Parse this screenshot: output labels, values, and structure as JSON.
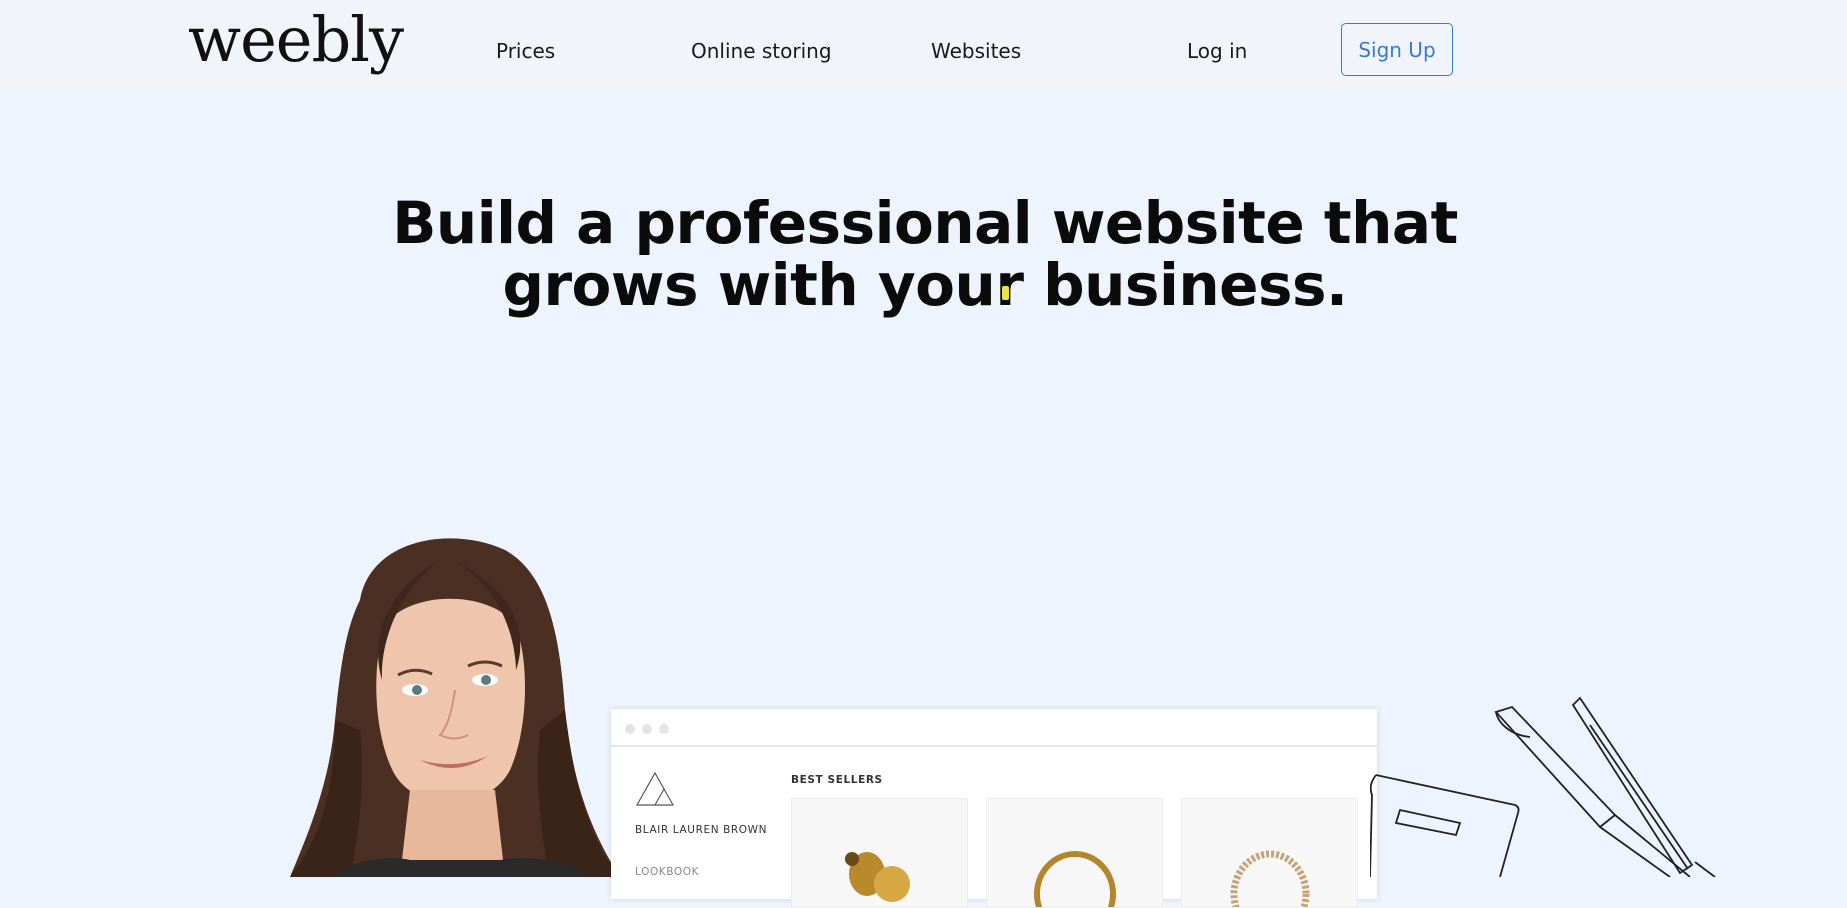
{
  "header": {
    "logo": "weebly",
    "nav": [
      "Prices",
      "Online storing",
      "Websites",
      "Log in"
    ],
    "signup_label": "Sign Up"
  },
  "hero": {
    "title_line1": "Build a professional website that",
    "title_line2": "grows with your business."
  },
  "mockup": {
    "brand": "BLAIR LAUREN BROWN",
    "menu_item": "LOOKBOOK",
    "section_title": "BEST SELLERS"
  },
  "colors": {
    "accent": "#3a78d6",
    "background": "#eef4fe",
    "header_bg": "#f1f4f8"
  }
}
